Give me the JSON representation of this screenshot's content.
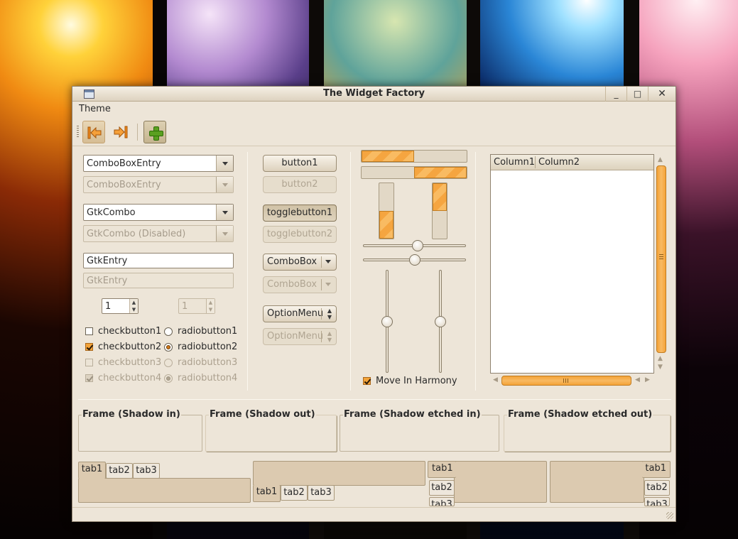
{
  "window": {
    "title": "The Widget Factory",
    "minimize": "_",
    "maximize": "□",
    "close": "✕"
  },
  "menubar": {
    "items": [
      "Theme"
    ]
  },
  "toolbar": {
    "icons": [
      "go-first-icon",
      "go-last-icon",
      "add-icon"
    ]
  },
  "left_column": {
    "combo_entry_1": "ComboBoxEntry",
    "combo_entry_2_disabled": "ComboBoxEntry",
    "gtk_combo": "GtkCombo",
    "gtk_combo_disabled": "GtkCombo (Disabled)",
    "entry": "GtkEntry",
    "entry_disabled": "GtkEntry",
    "spin_value": "1",
    "spin_disabled_value": "1",
    "checks": [
      {
        "label": "checkbutton1",
        "checked": false,
        "disabled": false
      },
      {
        "label": "checkbutton2",
        "checked": true,
        "disabled": false
      },
      {
        "label": "checkbutton3",
        "checked": false,
        "disabled": true
      },
      {
        "label": "checkbutton4",
        "checked": true,
        "disabled": true
      }
    ],
    "radios": [
      {
        "label": "radiobutton1",
        "selected": false,
        "disabled": false
      },
      {
        "label": "radiobutton2",
        "selected": true,
        "disabled": false
      },
      {
        "label": "radiobutton3",
        "selected": false,
        "disabled": true
      },
      {
        "label": "radiobutton4",
        "selected": true,
        "disabled": true
      }
    ]
  },
  "buttons": {
    "button1": "button1",
    "button2": "button2",
    "toggle1": "togglebutton1",
    "toggle2": "togglebutton2",
    "combo1": "ComboBox",
    "combo2": "ComboBox",
    "option1": "OptionMenu",
    "option2": "OptionMenu"
  },
  "progress": {
    "h1": 0.5,
    "h2": 0.5,
    "v1": 0.5,
    "v2": 0.5
  },
  "scales": {
    "h1": 0.5,
    "h2": 0.5,
    "v1": 0.5,
    "v2": 0.5
  },
  "harmony": {
    "label": "Move In Harmony",
    "checked": true
  },
  "treeview": {
    "columns": [
      "Column1",
      "Column2"
    ]
  },
  "frames": [
    "Frame (Shadow in)",
    "Frame (Shadow out)",
    "Frame (Shadow etched in)",
    "Frame (Shadow etched out)"
  ],
  "notebooks": {
    "tabs": [
      "tab1",
      "tab2",
      "tab3"
    ]
  },
  "colors": {
    "accent": "#f4a339",
    "window_bg": "#ede5d8",
    "notebook_panel": "#dccab0"
  }
}
